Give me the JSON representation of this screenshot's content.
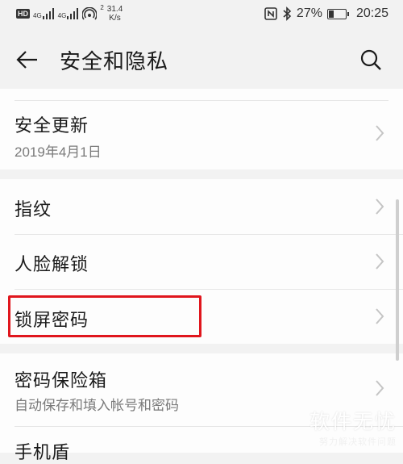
{
  "status_bar": {
    "hd": "HD",
    "net1": "4G",
    "net2": "4G",
    "speed_value": "31.4",
    "speed_unit": "K/s",
    "hotspot_count": "2",
    "battery_percent": "27%",
    "battery_level": 0.27,
    "time": "20:25"
  },
  "header": {
    "title": "安全和隐私"
  },
  "items": {
    "security_update": {
      "title": "安全更新",
      "subtitle": "2019年4月1日"
    },
    "fingerprint": {
      "title": "指纹"
    },
    "face_unlock": {
      "title": "人脸解锁"
    },
    "lock_screen_password": {
      "title": "锁屏密码"
    },
    "password_vault": {
      "title": "密码保险箱",
      "subtitle": "自动保存和填入帐号和密码"
    },
    "phone_finder": {
      "title": "手机盾"
    }
  },
  "watermark": {
    "main": "软件无忧",
    "sub": "努力解决软件问题"
  },
  "colors": {
    "background": "#f2f2f2",
    "card": "#fdfdfd",
    "highlight": "#e0161d"
  }
}
